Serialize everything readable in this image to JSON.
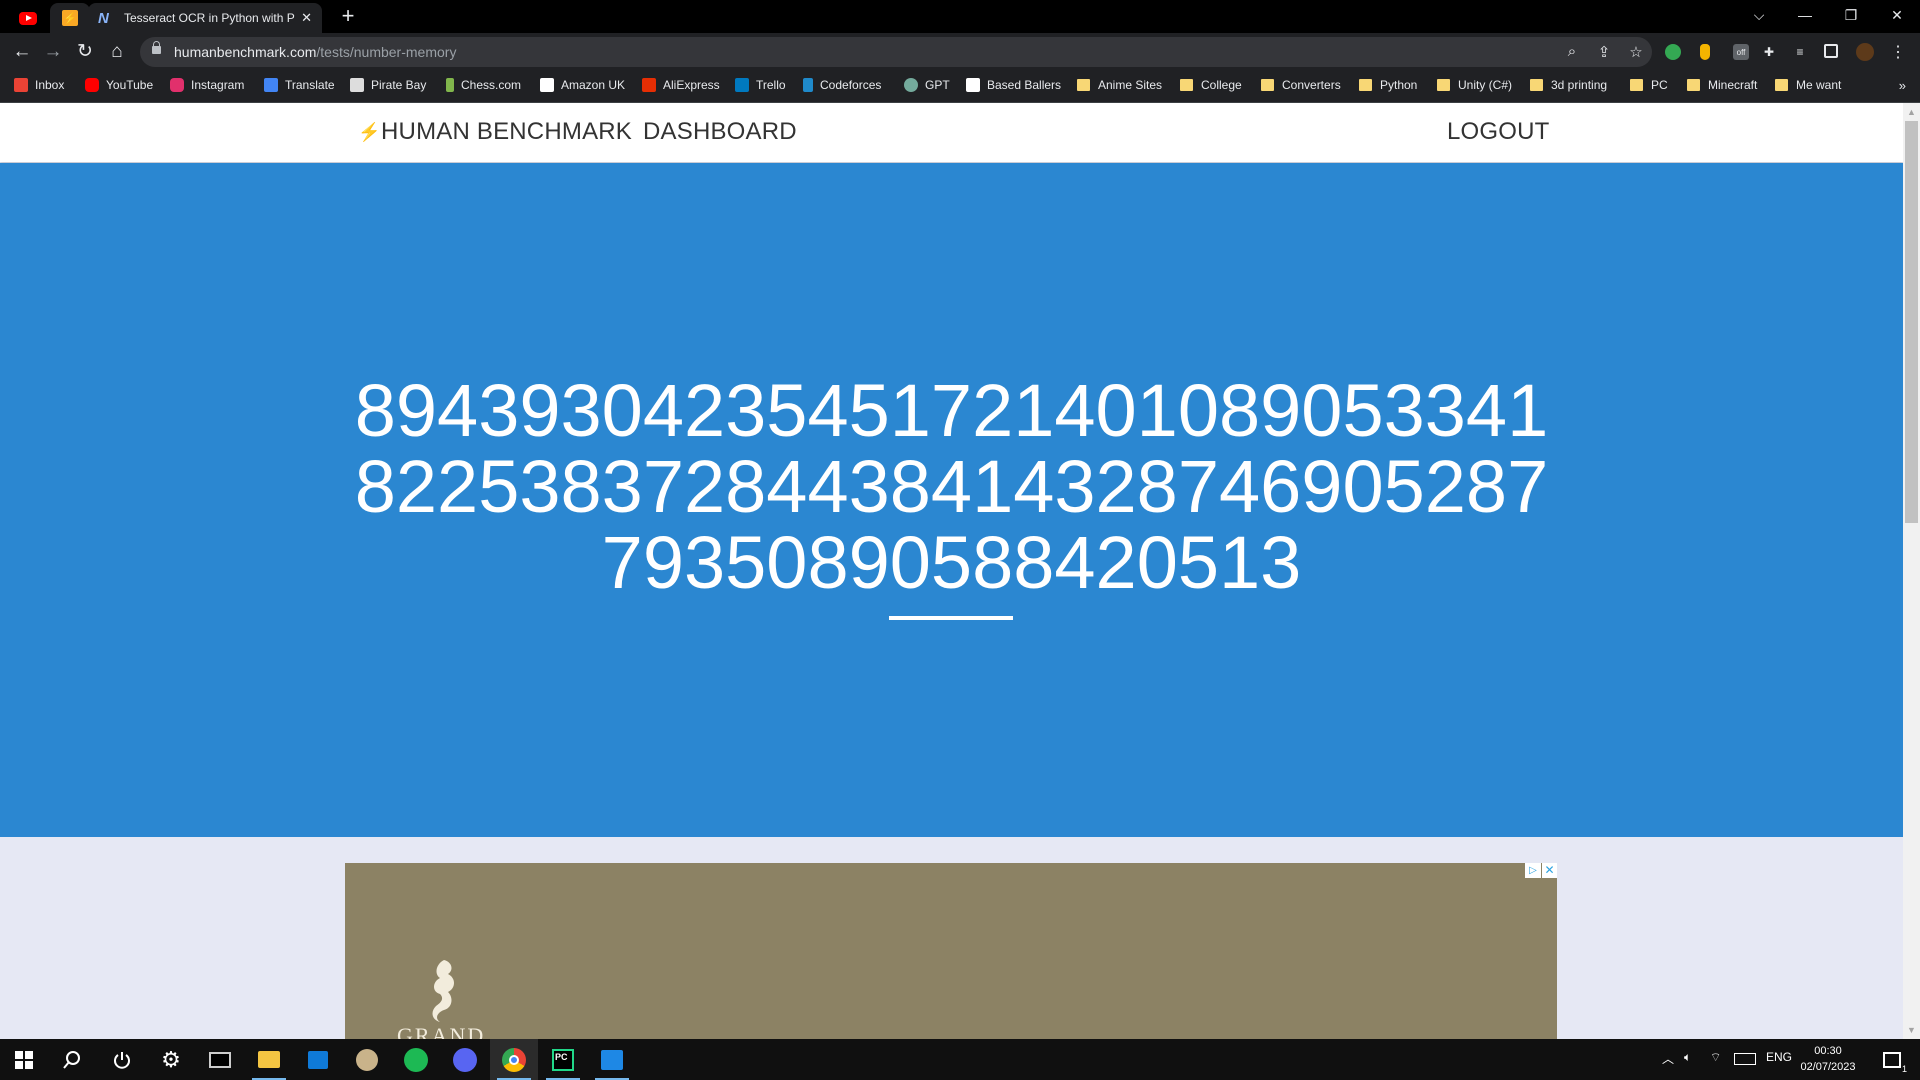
{
  "browser": {
    "active_tab_title": "Tesseract OCR in Python with Pyt",
    "tab_close": "✕",
    "new_tab": "+",
    "window_controls": {
      "tab_search": "⌵",
      "minimize": "—",
      "restore": "❐",
      "close": "✕"
    },
    "url_host": "humanbenchmark.com",
    "url_path": "/tests/number-memory"
  },
  "bookmarks": [
    {
      "label": "Inbox",
      "icon": "gmail-icon",
      "color": "#ea4335"
    },
    {
      "label": "YouTube",
      "icon": "youtube-icon",
      "color": "#ff0000"
    },
    {
      "label": "Instagram",
      "icon": "instagram-icon",
      "color": "#e1306c"
    },
    {
      "label": "Translate",
      "icon": "translate-icon",
      "color": "#4285f4"
    },
    {
      "label": "Pirate Bay",
      "icon": "pirate-bay-icon",
      "color": "#dddddd"
    },
    {
      "label": "Chess.com",
      "icon": "chess-icon",
      "color": "#81b64c"
    },
    {
      "label": "Amazon UK",
      "icon": "amazon-icon",
      "color": "#ffffff"
    },
    {
      "label": "AliExpress",
      "icon": "aliexpress-icon",
      "color": "#e62e04"
    },
    {
      "label": "Trello",
      "icon": "trello-icon",
      "color": "#0079bf"
    },
    {
      "label": "Codeforces",
      "icon": "codeforces-icon",
      "color": "#1f8acb"
    },
    {
      "label": "GPT",
      "icon": "openai-icon",
      "color": "#74aa9c"
    },
    {
      "label": "Based Ballers",
      "icon": "w-icon",
      "color": "#ffffff"
    },
    {
      "label": "Anime Sites",
      "icon": "folder-icon"
    },
    {
      "label": "College",
      "icon": "folder-icon"
    },
    {
      "label": "Converters",
      "icon": "folder-icon"
    },
    {
      "label": "Python",
      "icon": "folder-icon"
    },
    {
      "label": "Unity (C#)",
      "icon": "folder-icon"
    },
    {
      "label": "3d printing",
      "icon": "folder-icon"
    },
    {
      "label": "PC",
      "icon": "folder-icon"
    },
    {
      "label": "Minecraft",
      "icon": "folder-icon"
    },
    {
      "label": "Me want",
      "icon": "folder-icon"
    }
  ],
  "bookmarks_more": "»",
  "site": {
    "brand": "HUMAN BENCHMARK",
    "dashboard": "DASHBOARD",
    "logout": "LOGOUT"
  },
  "test": {
    "number_lines": [
      "89439304235451721401089053341",
      "82253837284438414328746905287",
      "7935089058842051 3"
    ],
    "time_remaining_fraction": 0.0
  },
  "ad": {
    "brand_text": "GRAND",
    "choices": "✕",
    "play": "▷"
  },
  "taskbar": {
    "language": "ENG",
    "time": "00:30",
    "date": "02/07/2023",
    "notification_count": "1"
  },
  "colors": {
    "hero_blue": "#2b87d1",
    "page_bg": "#e6e8f4",
    "ad_bg": "#8c8264"
  }
}
